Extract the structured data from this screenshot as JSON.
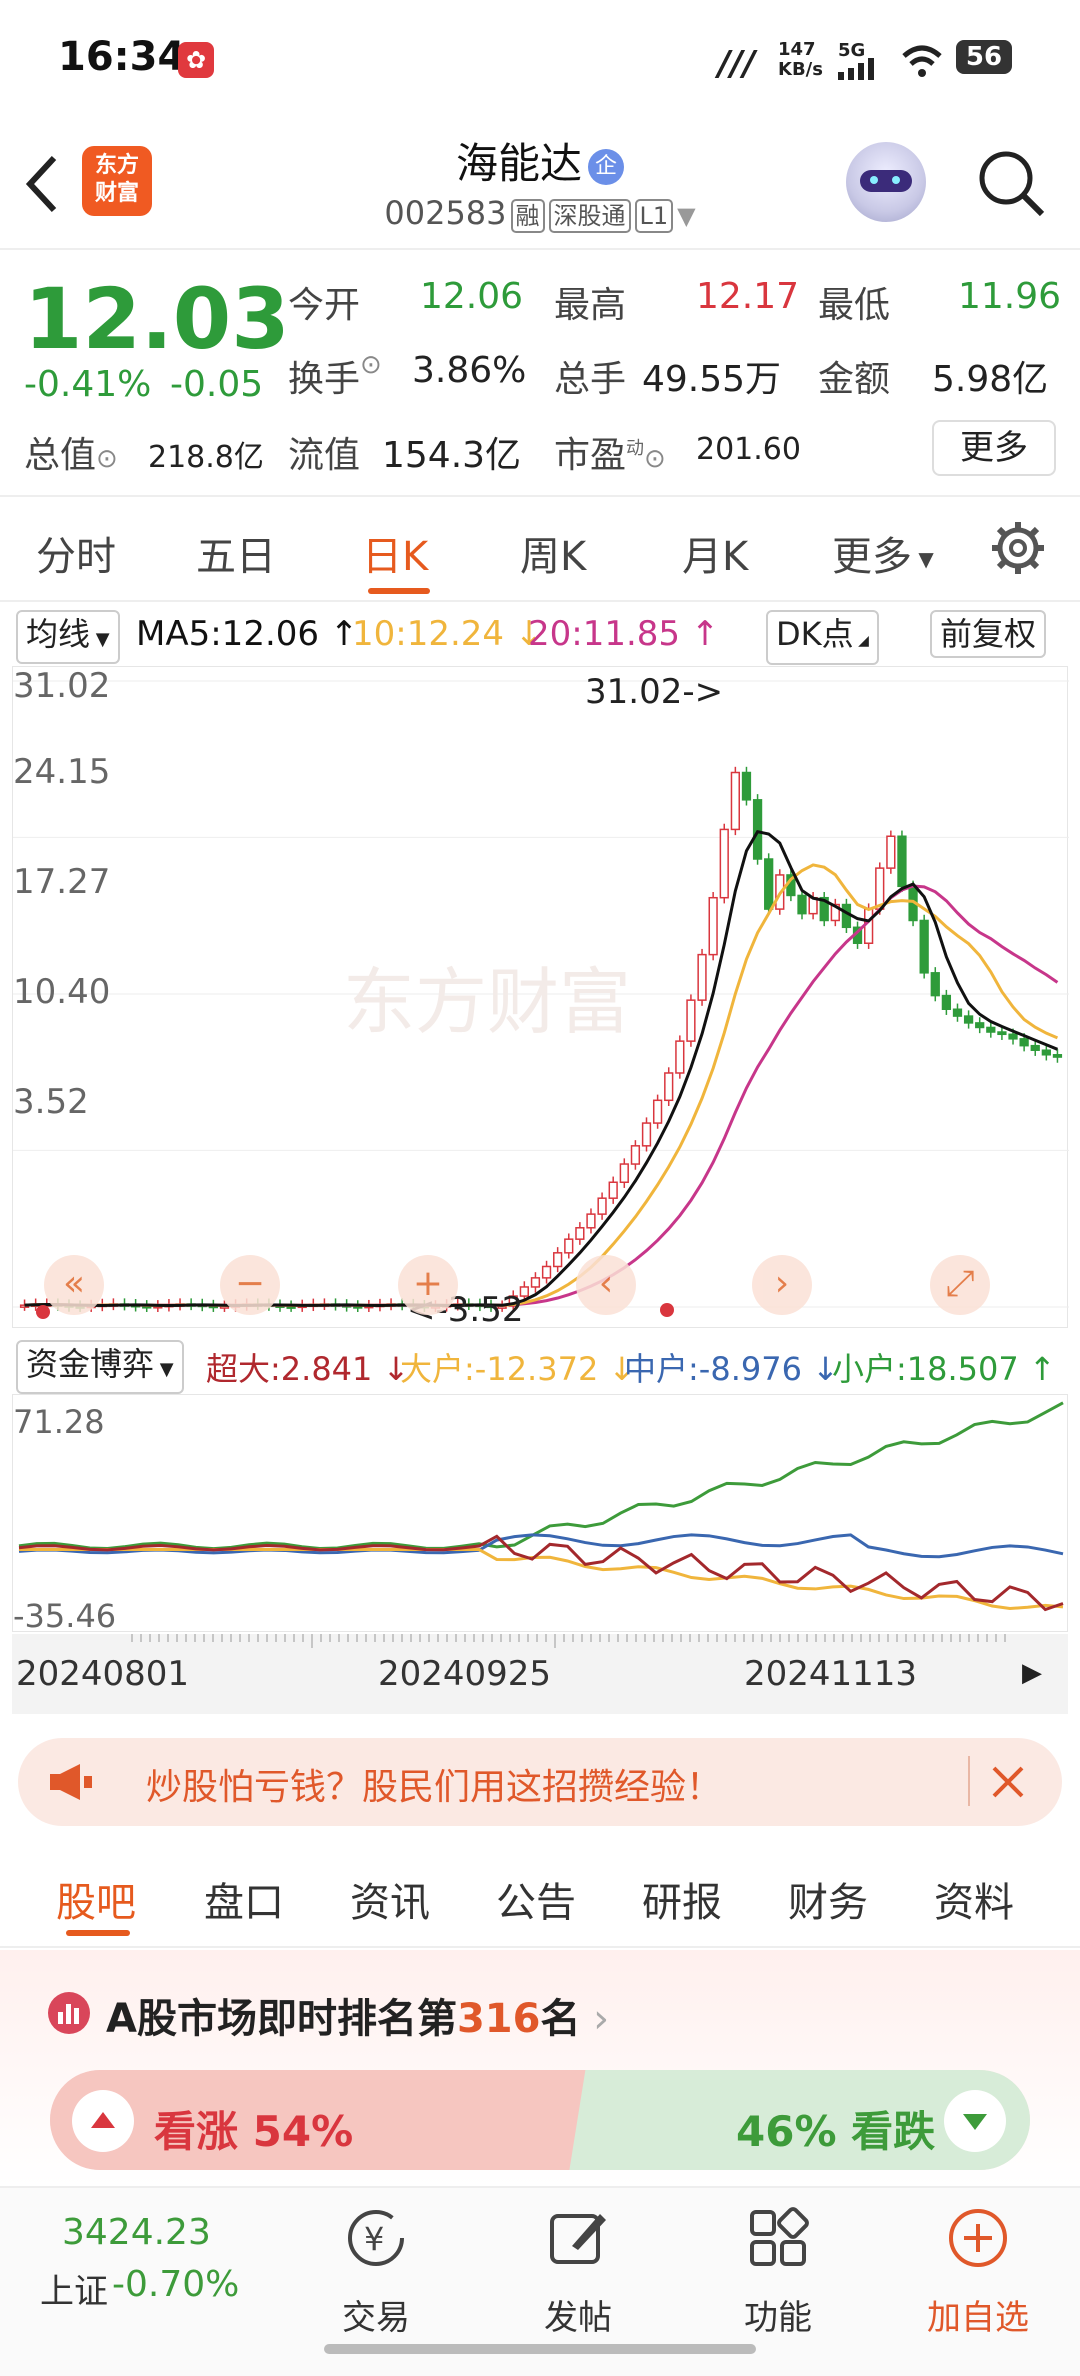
{
  "status_bar": {
    "time": "16:34",
    "net_speed": "147\nKB/s",
    "signal": "5G",
    "battery": "56"
  },
  "header": {
    "logo_text_line1": "东方",
    "logo_text_line2": "财富",
    "stock_name": "海能达",
    "stock_badge": "企",
    "stock_code": "002583",
    "tags": [
      "融",
      "深股通",
      "L1"
    ]
  },
  "quote": {
    "price": "12.03",
    "change_pct": "-0.41%",
    "change": "-0.05",
    "open_label": "今开",
    "open": "12.06",
    "high_label": "最高",
    "high": "12.17",
    "low_label": "最低",
    "low": "11.96",
    "turnover_label": "换手",
    "turnover": "3.86%",
    "volume_label": "总手",
    "volume": "49.55万",
    "amount_label": "金额",
    "amount": "5.98亿",
    "mcap_label": "总值",
    "mcap": "218.8亿",
    "float_label": "流值",
    "float": "154.3亿",
    "pe_label": "市盈",
    "pe_sup": "动",
    "pe": "201.60",
    "more_label": "更多"
  },
  "chart_tabs": [
    "分时",
    "五日",
    "日K",
    "周K",
    "月K",
    "更多"
  ],
  "active_chart_tab": "日K",
  "ma_row": {
    "indicator": "均线",
    "ma5": "MA5:12.06 ↑",
    "ma10": "10:12.24 ↓",
    "ma20": "20:11.85 ↑",
    "dk": "DK点",
    "adjust": "前复权"
  },
  "kline": {
    "y_ticks": [
      "31.02",
      "24.15",
      "17.27",
      "10.40",
      "3.52"
    ],
    "max_marker": "31.02->",
    "min_marker": "<-3.52",
    "watermark": "东方财富",
    "colors": {
      "up": "#d9363e",
      "down": "#2e9b3a",
      "ma5": "#111111",
      "ma10": "#f0b53c",
      "ma20": "#c7368a"
    }
  },
  "fund_row": {
    "indicator": "资金博弈",
    "super": "超大:2.841 ↓",
    "large": "大户:-12.372 ↓",
    "medium": "中户:-8.976 ↓",
    "small": "小户:18.507 ↑"
  },
  "fund_chart": {
    "y_ticks": [
      "71.28",
      "-35.46"
    ]
  },
  "dates": [
    "20240801",
    "20240925",
    "20241113"
  ],
  "banner": {
    "text": "炒股怕亏钱？股民们用这招攒经验！"
  },
  "bottom_tabs": [
    "股吧",
    "盘口",
    "资讯",
    "公告",
    "研报",
    "财务",
    "资料"
  ],
  "rank": {
    "prefix": "A股市场即时排名第",
    "rank": "316",
    "suffix": "名"
  },
  "vote": {
    "up_label": "看涨",
    "up_pct": "54%",
    "down_pct": "46%",
    "down_label": "看跌",
    "up_fraction": 0.54
  },
  "bottom_nav": {
    "index_value": "3424.23",
    "index_name": "上证",
    "index_change": "-0.70%",
    "items": [
      "交易",
      "发帖",
      "功能",
      "加自选"
    ]
  }
}
